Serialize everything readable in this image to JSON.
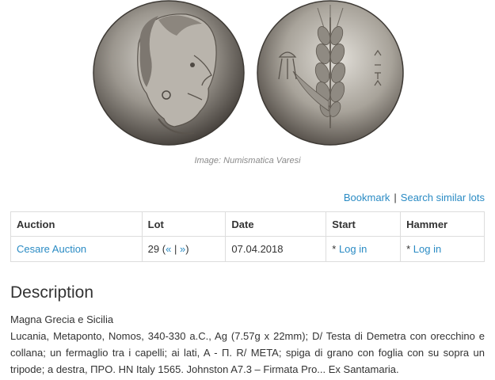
{
  "image": {
    "obverse_alt": "coin obverse",
    "reverse_alt": "coin reverse",
    "caption": "Image: Numismatica Varesi"
  },
  "actions": {
    "bookmark": "Bookmark",
    "separator": "|",
    "search_similar": "Search similar lots"
  },
  "table": {
    "headers": {
      "auction": "Auction",
      "lot": "Lot",
      "date": "Date",
      "start": "Start",
      "hammer": "Hammer"
    },
    "row": {
      "auction": "Cesare Auction",
      "lot_number": "29",
      "lot_prev": "«",
      "lot_sep": "|",
      "lot_next": "»",
      "date": "07.04.2018",
      "start_prefix": "*",
      "start_link": "Log in",
      "hammer_prefix": "*",
      "hammer_link": "Log in"
    }
  },
  "description": {
    "heading": "Description",
    "line1": "Magna Grecia e Sicilia",
    "line2": "Lucania, Metaponto, Nomos, 340-330 a.C., Ag (7.57g x 22mm); D/ Testa di Demetra con orecchino e collana; un fermaglio tra i capelli; ai lati, A - Π. R/ META; spiga di grano con foglia con su sopra un tripode; a destra, ΠPO. HN Italy 1565. Johnston A7.3 – Firmata Pro... Ex Santamaria."
  },
  "colors": {
    "link": "#2a8bc4",
    "border": "#dddddd",
    "coin_light": "#c9c6c0",
    "coin_dark": "#4a4540"
  }
}
